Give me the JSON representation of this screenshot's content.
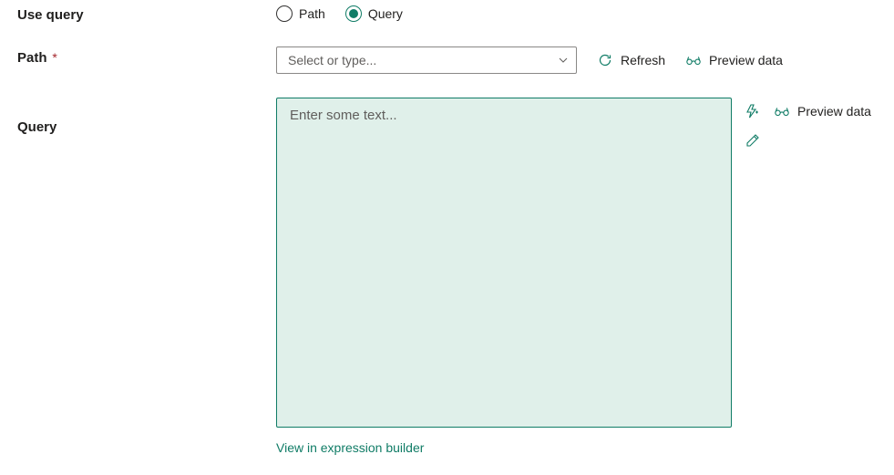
{
  "labels": {
    "use_query": "Use query",
    "path": "Path",
    "query": "Query"
  },
  "radios": {
    "path": "Path",
    "query": "Query",
    "selected": "query"
  },
  "path_select": {
    "placeholder": "Select or type..."
  },
  "actions": {
    "refresh": "Refresh",
    "preview_data": "Preview data"
  },
  "query_area": {
    "placeholder": "Enter some text..."
  },
  "links": {
    "expression_builder": "View in expression builder"
  }
}
